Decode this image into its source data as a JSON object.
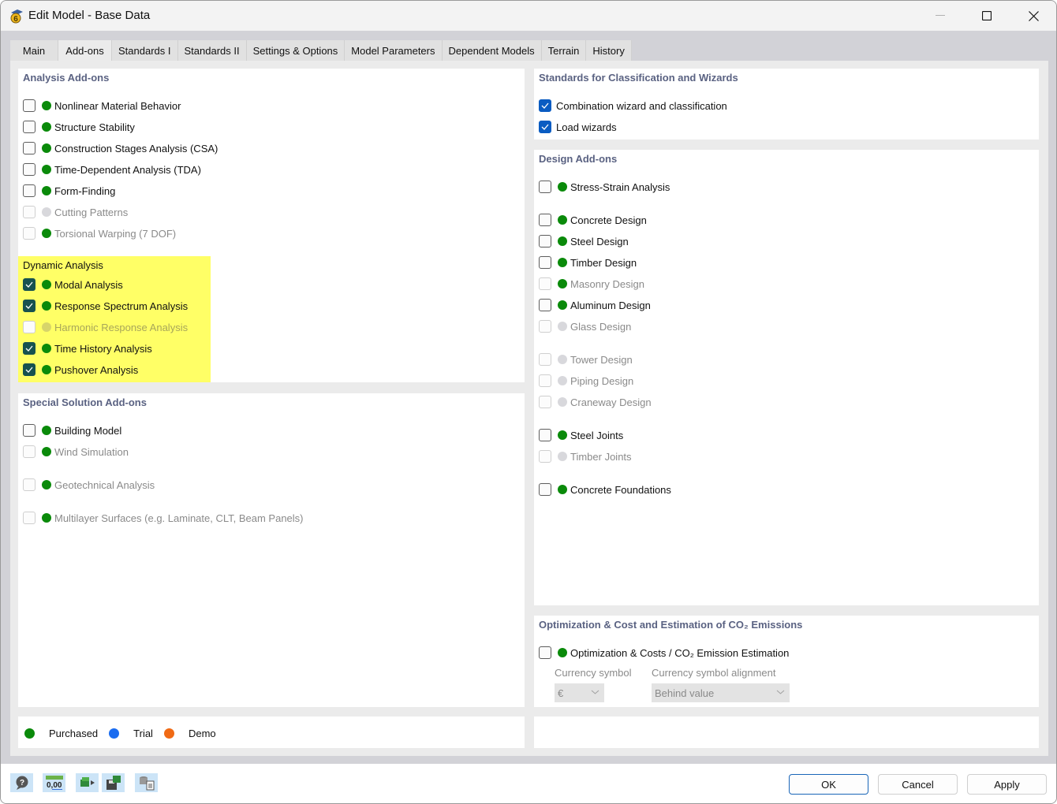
{
  "window": {
    "title": "Edit Model - Base Data",
    "controls": {
      "minimize": "minimize",
      "maximize": "maximize",
      "close": "close"
    }
  },
  "tabs": [
    {
      "label": "Main",
      "active": false
    },
    {
      "label": "Add-ons",
      "active": true
    },
    {
      "label": "Standards I",
      "active": false
    },
    {
      "label": "Standards II",
      "active": false
    },
    {
      "label": "Settings & Options",
      "active": false
    },
    {
      "label": "Model Parameters",
      "active": false
    },
    {
      "label": "Dependent Models",
      "active": false
    },
    {
      "label": "Terrain",
      "active": false
    },
    {
      "label": "History",
      "active": false
    }
  ],
  "analysis_addons": {
    "title": "Analysis Add-ons",
    "items": [
      {
        "label": "Nonlinear Material Behavior",
        "checked": false,
        "enabled": true,
        "license": "purchased"
      },
      {
        "label": "Structure Stability",
        "checked": false,
        "enabled": true,
        "license": "purchased"
      },
      {
        "label": "Construction Stages Analysis (CSA)",
        "checked": false,
        "enabled": true,
        "license": "purchased"
      },
      {
        "label": "Time-Dependent Analysis (TDA)",
        "checked": false,
        "enabled": true,
        "license": "purchased"
      },
      {
        "label": "Form-Finding",
        "checked": false,
        "enabled": true,
        "license": "purchased"
      },
      {
        "label": "Cutting Patterns",
        "checked": false,
        "enabled": false,
        "license": "none"
      },
      {
        "label": "Torsional Warping (7 DOF)",
        "checked": false,
        "enabled": false,
        "license": "purchased"
      }
    ],
    "dynamic": {
      "title": "Dynamic Analysis",
      "items": [
        {
          "label": "Modal Analysis",
          "checked": true,
          "enabled": true,
          "license": "purchased"
        },
        {
          "label": "Response Spectrum Analysis",
          "checked": true,
          "enabled": true,
          "license": "purchased"
        },
        {
          "label": "Harmonic Response Analysis",
          "checked": false,
          "enabled": false,
          "license": "none"
        },
        {
          "label": "Time History Analysis",
          "checked": true,
          "enabled": true,
          "license": "purchased"
        },
        {
          "label": "Pushover Analysis",
          "checked": true,
          "enabled": true,
          "license": "purchased"
        }
      ]
    }
  },
  "special_addons": {
    "title": "Special Solution Add-ons",
    "items": [
      {
        "label": "Building Model",
        "checked": false,
        "enabled": true,
        "license": "purchased"
      },
      {
        "label": "Wind Simulation",
        "checked": false,
        "enabled": false,
        "license": "purchased"
      },
      {
        "label": "Geotechnical Analysis",
        "checked": false,
        "enabled": false,
        "license": "purchased"
      },
      {
        "label": "Multilayer Surfaces (e.g. Laminate, CLT, Beam Panels)",
        "checked": false,
        "enabled": false,
        "license": "purchased"
      }
    ]
  },
  "standards_wizards": {
    "title": "Standards for Classification and Wizards",
    "items": [
      {
        "label": "Combination wizard and classification",
        "checked": true
      },
      {
        "label": "Load wizards",
        "checked": true
      }
    ]
  },
  "design_addons": {
    "title": "Design Add-ons",
    "items": [
      {
        "label": "Stress-Strain Analysis",
        "checked": false,
        "enabled": true,
        "license": "purchased"
      },
      {
        "label": "Concrete Design",
        "checked": false,
        "enabled": true,
        "license": "purchased"
      },
      {
        "label": "Steel Design",
        "checked": false,
        "enabled": true,
        "license": "purchased"
      },
      {
        "label": "Timber Design",
        "checked": false,
        "enabled": true,
        "license": "purchased"
      },
      {
        "label": "Masonry Design",
        "checked": false,
        "enabled": false,
        "license": "purchased"
      },
      {
        "label": "Aluminum Design",
        "checked": false,
        "enabled": true,
        "license": "purchased"
      },
      {
        "label": "Glass Design",
        "checked": false,
        "enabled": false,
        "license": "none"
      },
      {
        "label": "Tower Design",
        "checked": false,
        "enabled": false,
        "license": "none"
      },
      {
        "label": "Piping Design",
        "checked": false,
        "enabled": false,
        "license": "none"
      },
      {
        "label": "Craneway Design",
        "checked": false,
        "enabled": false,
        "license": "none"
      },
      {
        "label": "Steel Joints",
        "checked": false,
        "enabled": true,
        "license": "purchased"
      },
      {
        "label": "Timber Joints",
        "checked": false,
        "enabled": false,
        "license": "none"
      },
      {
        "label": "Concrete Foundations",
        "checked": false,
        "enabled": true,
        "license": "purchased"
      }
    ]
  },
  "optimization": {
    "title": "Optimization & Cost and Estimation of CO₂ Emissions",
    "item": {
      "label": "Optimization & Costs / CO₂ Emission Estimation",
      "checked": false,
      "enabled": true,
      "license": "purchased"
    },
    "currency_symbol_label": "Currency symbol",
    "currency_symbol_value": "€",
    "alignment_label": "Currency symbol alignment",
    "alignment_value": "Behind value"
  },
  "legend": [
    {
      "label": "Purchased",
      "color": "#0a8a0a"
    },
    {
      "label": "Trial",
      "color": "#1a6cf0"
    },
    {
      "label": "Demo",
      "color": "#f06a14"
    }
  ],
  "colors": {
    "highlight": "#ffff66",
    "section_title": "#5a6282",
    "checked_dark": "#17524f",
    "checked_blue": "#0a5cc2"
  },
  "footer": {
    "tools": [
      "help-icon",
      "units-icon",
      "model-export-icon",
      "save-model-icon",
      "database-report-icon"
    ],
    "units_text": "0,00",
    "ok_label": "OK",
    "cancel_label": "Cancel",
    "apply_label": "Apply"
  }
}
